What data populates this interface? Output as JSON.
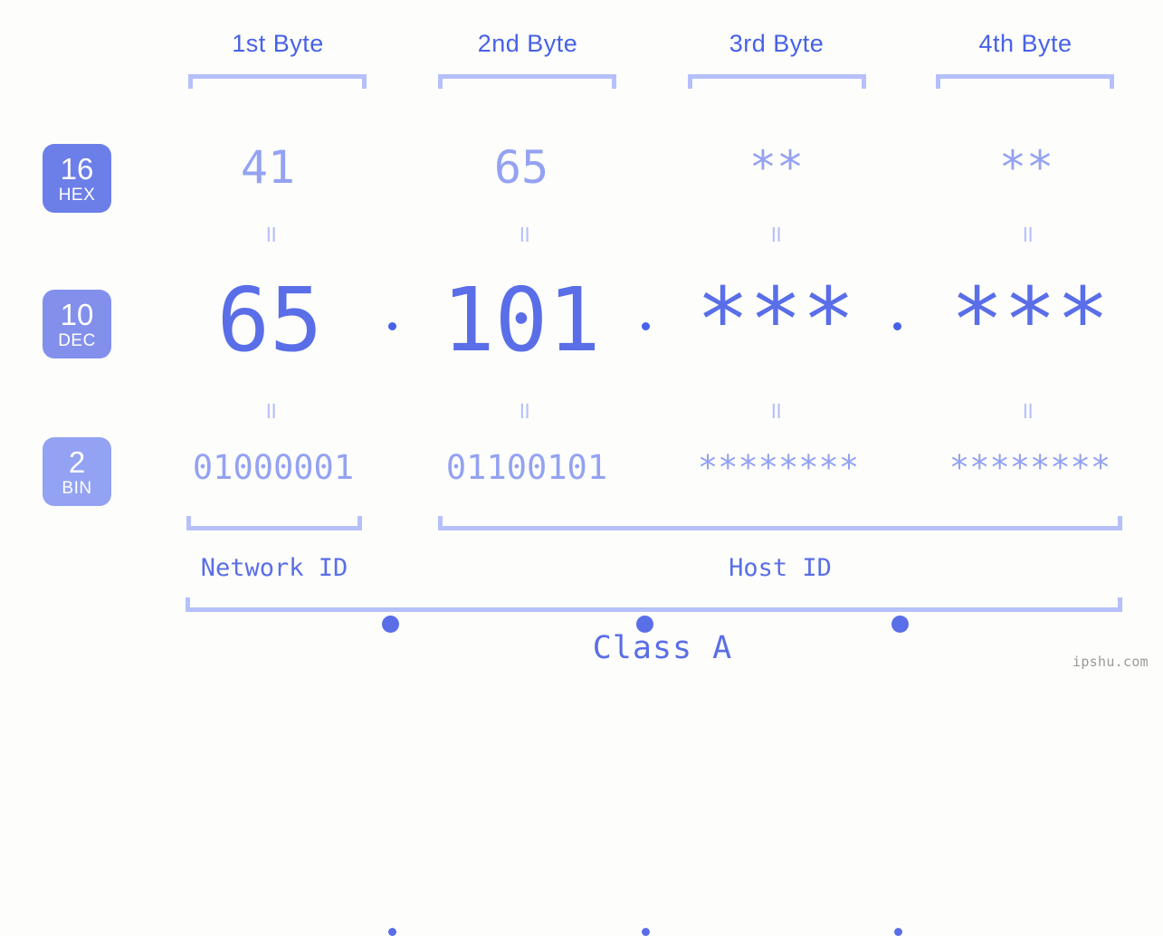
{
  "byte_headers": [
    {
      "label": "1st Byte"
    },
    {
      "label": "2nd Byte"
    },
    {
      "label": "3rd Byte"
    },
    {
      "label": "4th Byte"
    }
  ],
  "bases": [
    {
      "number": "16",
      "name": "HEX",
      "color": "#6c7ee8"
    },
    {
      "number": "10",
      "name": "DEC",
      "color": "#8290ec"
    },
    {
      "number": "2",
      "name": "BIN",
      "color": "#93a2f2"
    }
  ],
  "rows": {
    "hex": {
      "base_number": "16",
      "base_name": "HEX",
      "values": [
        "41",
        "65",
        "**",
        "**"
      ],
      "separator": ".",
      "color": "#94a2f2"
    },
    "dec": {
      "base_number": "10",
      "base_name": "DEC",
      "values": [
        "65",
        "101",
        "***",
        "***"
      ],
      "separator": ".",
      "color": "#5a6ee8"
    },
    "bin": {
      "base_number": "2",
      "base_name": "BIN",
      "values": [
        "01000001",
        "01100101",
        "********",
        "********"
      ],
      "separator": ".",
      "color": "#94a2f2"
    }
  },
  "equality_symbol": "॥",
  "sections": {
    "network_id": "Network ID",
    "host_id": "Host ID",
    "class": "Class A"
  },
  "watermark": "ipshu.com",
  "colors": {
    "background": "#fdfefb",
    "bracket": "#b6c0fb",
    "header_text": "#4761e8",
    "accent_strong": "#5a6ee8",
    "accent_light": "#94a2f2"
  }
}
